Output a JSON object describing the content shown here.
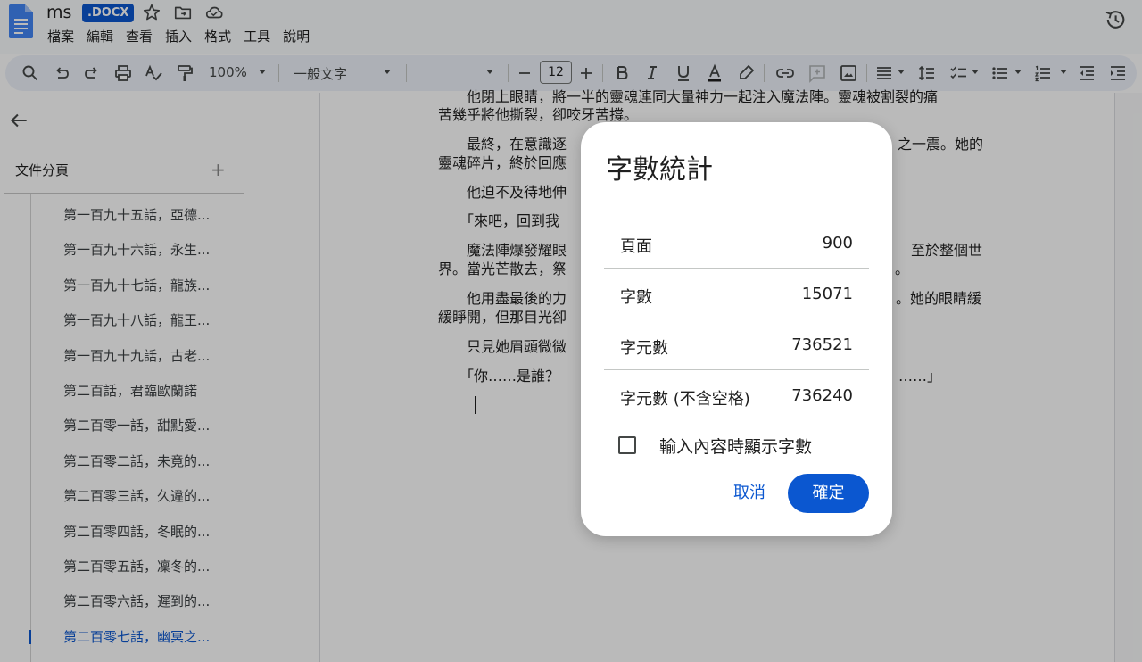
{
  "header": {
    "doc_title": "ms",
    "file_type_badge": ".DOCX",
    "menu": [
      "檔案",
      "編輯",
      "查看",
      "插入",
      "格式",
      "工具",
      "說明"
    ]
  },
  "toolbar": {
    "zoom": "100%",
    "style": "一般文字",
    "font_size": "12",
    "text_color": "#1f1f1f"
  },
  "sidebar": {
    "title": "文件分頁",
    "add_symbol": "+",
    "items": [
      "第一百九十五話，亞德...",
      "第一百九十六話，永生...",
      "第一百九十七話，龍族...",
      "第一百九十八話，龍王...",
      "第一百九十九話，古老...",
      "第二百話，君臨歐蘭諾",
      "第二百零一話，甜點愛...",
      "第二百零二話，未竟的...",
      "第二百零三話，久違的...",
      "第二百零四話，冬眠的...",
      "第二百零五話，凜冬的...",
      "第二百零六話，遲到的...",
      "第二百零七話，幽冥之..."
    ],
    "active_index": 12
  },
  "document": {
    "paragraphs": [
      "　　他閉上眼睛，將一半的靈魂連同大量神力一起注入魔法陣。靈魂被割裂的痛",
      "苦幾乎將他撕裂，卻咬牙苦撐。",
      "　　最終，在意識逐",
      "之一震。她的",
      "靈魂碎片，終於回應",
      "　　他迫不及待地伸",
      "　　「來吧，回到我",
      "　　魔法陣爆發耀眼",
      "至於整個世",
      "界。當光芒散去，祭",
      "。",
      "　　他用盡最後的力",
      "。她的眼睛緩",
      "緩睜開，但那目光卻",
      "　　只見她眉頭微微",
      "　　「你……是誰？",
      "……」"
    ]
  },
  "dialog": {
    "title": "字數統計",
    "stats": [
      {
        "label": "頁面",
        "value": "900"
      },
      {
        "label": "字數",
        "value": "15071"
      },
      {
        "label": "字元數",
        "value": "736521"
      },
      {
        "label": "字元數 (不含空格)",
        "value": "736240"
      }
    ],
    "checkbox_label": "輸入內容時顯示字數",
    "checkbox_checked": false,
    "cancel_label": "取消",
    "ok_label": "確定"
  }
}
